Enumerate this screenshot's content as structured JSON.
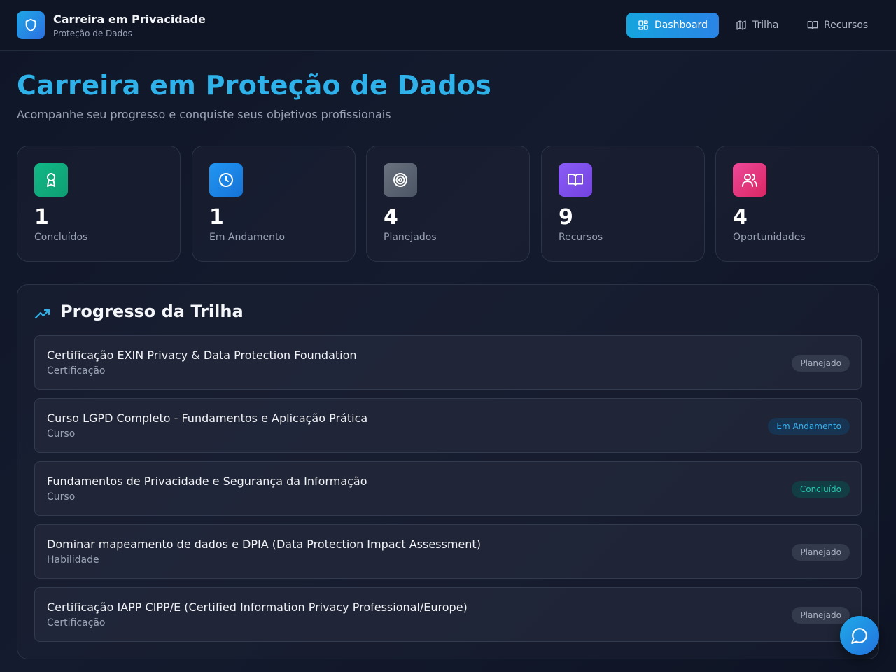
{
  "header": {
    "brand_title": "Carreira em Privacidade",
    "brand_subtitle": "Proteção de Dados",
    "logo_icon": "shield-icon",
    "nav": [
      {
        "label": "Dashboard",
        "icon": "layout-grid-icon",
        "active": true
      },
      {
        "label": "Trilha",
        "icon": "map-icon",
        "active": false
      },
      {
        "label": "Recursos",
        "icon": "book-open-icon",
        "active": false
      }
    ]
  },
  "page": {
    "title": "Carreira em Proteção de Dados",
    "subtitle": "Acompanhe seu progresso e conquiste seus objetivos profissionais"
  },
  "stats": [
    {
      "value": "1",
      "label": "Concluídos",
      "icon": "award-icon",
      "color": "#10b981"
    },
    {
      "value": "1",
      "label": "Em Andamento",
      "icon": "clock-icon",
      "color": "#1e88e5"
    },
    {
      "value": "4",
      "label": "Planejados",
      "icon": "target-icon",
      "color": "#6b7280"
    },
    {
      "value": "9",
      "label": "Recursos",
      "icon": "book-open-icon",
      "color": "#8b5cf6"
    },
    {
      "value": "4",
      "label": "Oportunidades",
      "icon": "users-icon",
      "color": "#ec4899"
    }
  ],
  "progress": {
    "title": "Progresso da Trilha",
    "icon": "trending-up-icon",
    "items": [
      {
        "title": "Certificação EXIN Privacy & Data Protection Foundation",
        "type": "Certificação",
        "status": "Planejado"
      },
      {
        "title": "Curso LGPD Completo - Fundamentos e Aplicação Prática",
        "type": "Curso",
        "status": "Em Andamento"
      },
      {
        "title": "Fundamentos de Privacidade e Segurança da Informação",
        "type": "Curso",
        "status": "Concluído"
      },
      {
        "title": "Dominar mapeamento de dados e DPIA (Data Protection Impact Assessment)",
        "type": "Habilidade",
        "status": "Planejado"
      },
      {
        "title": "Certificação IAPP CIPP/E (Certified Information Privacy Professional/Europe)",
        "type": "Certificação",
        "status": "Planejado"
      }
    ]
  },
  "chat": {
    "icon": "message-circle-icon"
  }
}
